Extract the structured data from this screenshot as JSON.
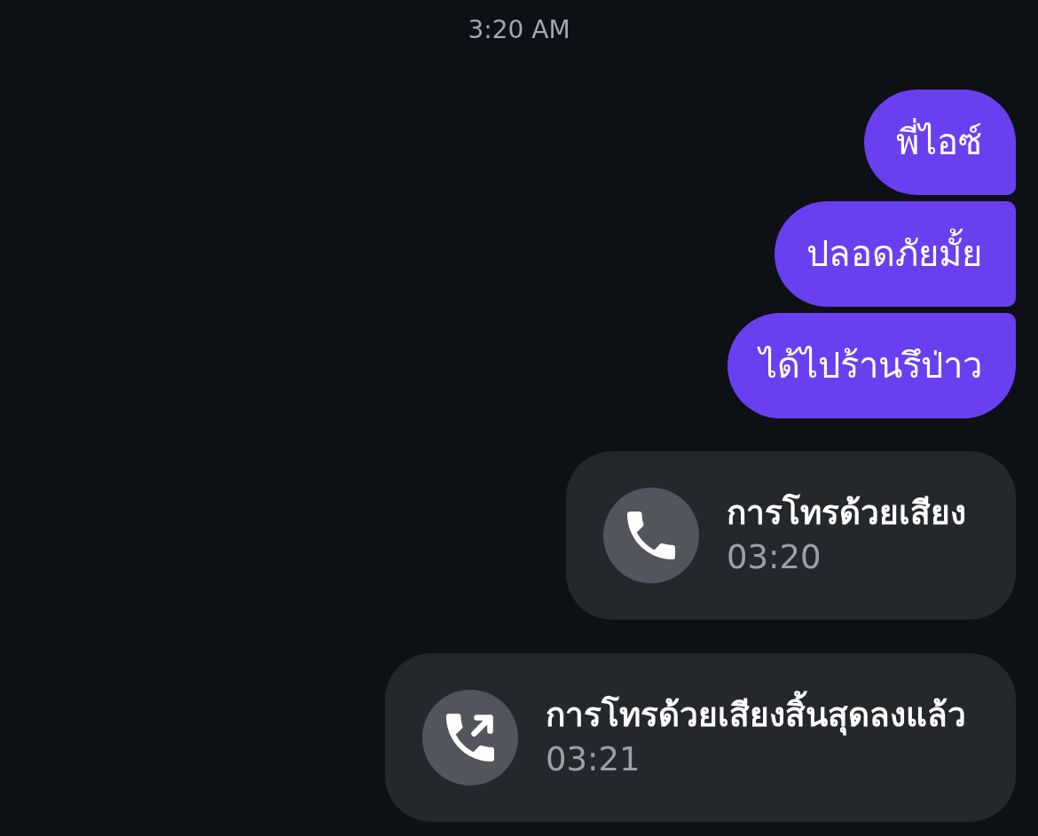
{
  "timestamp": "3:20 AM",
  "messages": [
    {
      "kind": "text",
      "text": "พี่ไอซ์"
    },
    {
      "kind": "text",
      "text": "ปลอดภัยมั้ย"
    },
    {
      "kind": "text",
      "text": "ได้ไปร้านรึป่าว"
    },
    {
      "kind": "call",
      "title": "การโทรด้วยเสียง",
      "time": "03:20",
      "ended": false
    },
    {
      "kind": "call",
      "title": "การโทรด้วยเสียงสิ้นสุดลงแล้ว",
      "time": "03:21",
      "ended": true
    }
  ]
}
